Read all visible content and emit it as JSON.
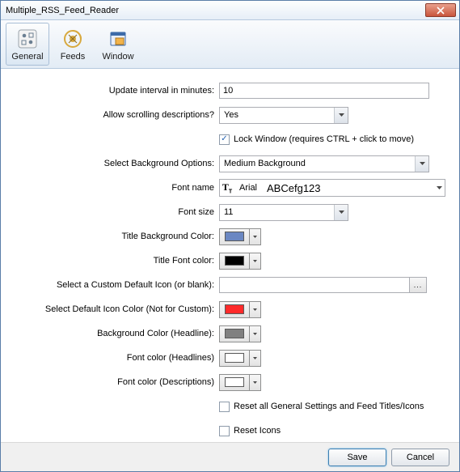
{
  "window": {
    "title": "Multiple_RSS_Feed_Reader"
  },
  "tabs": {
    "general": "General",
    "feeds": "Feeds",
    "window": "Window"
  },
  "form": {
    "update_interval": {
      "label": "Update interval in minutes:",
      "value": "10"
    },
    "allow_scroll": {
      "label": "Allow scrolling descriptions?",
      "value": "Yes"
    },
    "lock_window": {
      "label": "Lock Window (requires CTRL + click to move)"
    },
    "bg_options": {
      "label": "Select Background Options:",
      "value": "Medium Background"
    },
    "font_name": {
      "label": "Font name",
      "value": "Arial",
      "sample": "ABCefg123"
    },
    "font_size": {
      "label": "Font size",
      "value": "11"
    },
    "title_bg": {
      "label": "Title Background Color:",
      "color": "#6a87c2"
    },
    "title_font": {
      "label": "Title Font color:",
      "color": "#000000"
    },
    "custom_icon": {
      "label": "Select a Custom Default Icon (or blank):",
      "value": ""
    },
    "icon_color": {
      "label": "Select Default Icon Color (Not for Custom):",
      "color": "#ff2a2a"
    },
    "headline_bg": {
      "label": "Background Color (Headline):",
      "color": "#808080"
    },
    "headline_font": {
      "label": "Font color (Headlines)",
      "color": "#ffffff"
    },
    "desc_font": {
      "label": "Font color (Descriptions)",
      "color": "#ffffff"
    },
    "reset_all": {
      "label": "Reset all General Settings and Feed Titles/Icons"
    },
    "reset_icons": {
      "label": "Reset Icons"
    }
  },
  "buttons": {
    "save": "Save",
    "cancel": "Cancel"
  }
}
